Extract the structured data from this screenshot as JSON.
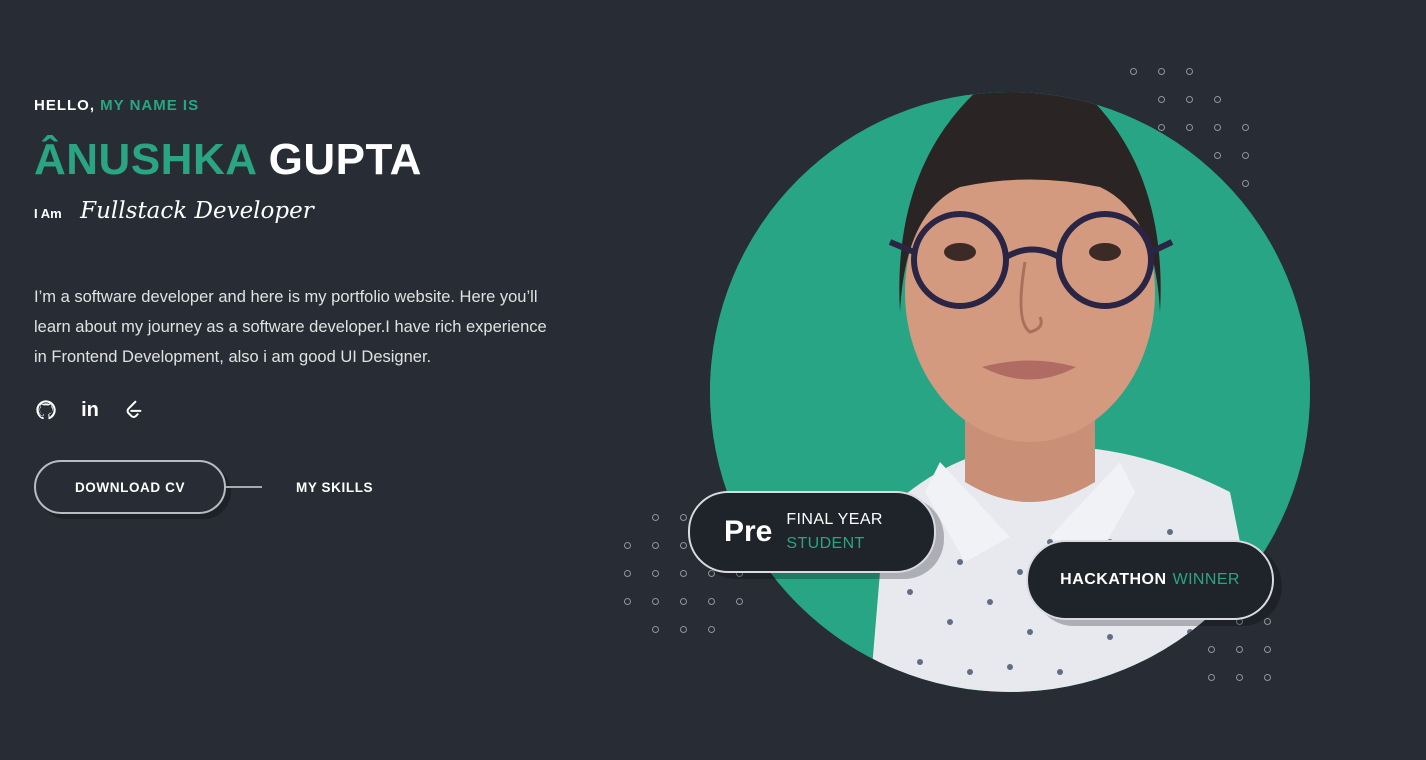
{
  "hero": {
    "hello": "HELLO,",
    "hello_accent": "MY NAME IS",
    "first_name": "ÂNUSHKA",
    "last_name": "GUPTA",
    "iam": "I Am",
    "role": "Fullstack Developer",
    "description": "I’m a software developer and here is my portfolio website. Here you’ll learn about my journey as a software developer.I have rich experience in Frontend Development, also i am good UI Designer."
  },
  "socials": [
    {
      "icon": "github-icon"
    },
    {
      "icon": "linkedin-icon",
      "label": "in"
    },
    {
      "icon": "leetcode-icon"
    }
  ],
  "actions": {
    "download_cv": "DOWNLOAD CV",
    "my_skills": "MY SKILLS"
  },
  "badges": {
    "pre_big": "Pre",
    "pre_line1": "FINAL YEAR",
    "pre_line2": "STUDENT",
    "hack_a": "HACKATHON",
    "hack_b": "WINNER"
  },
  "colors": {
    "background": "#282d35",
    "accent": "#2aa584",
    "badge_bg": "#1f232a"
  }
}
